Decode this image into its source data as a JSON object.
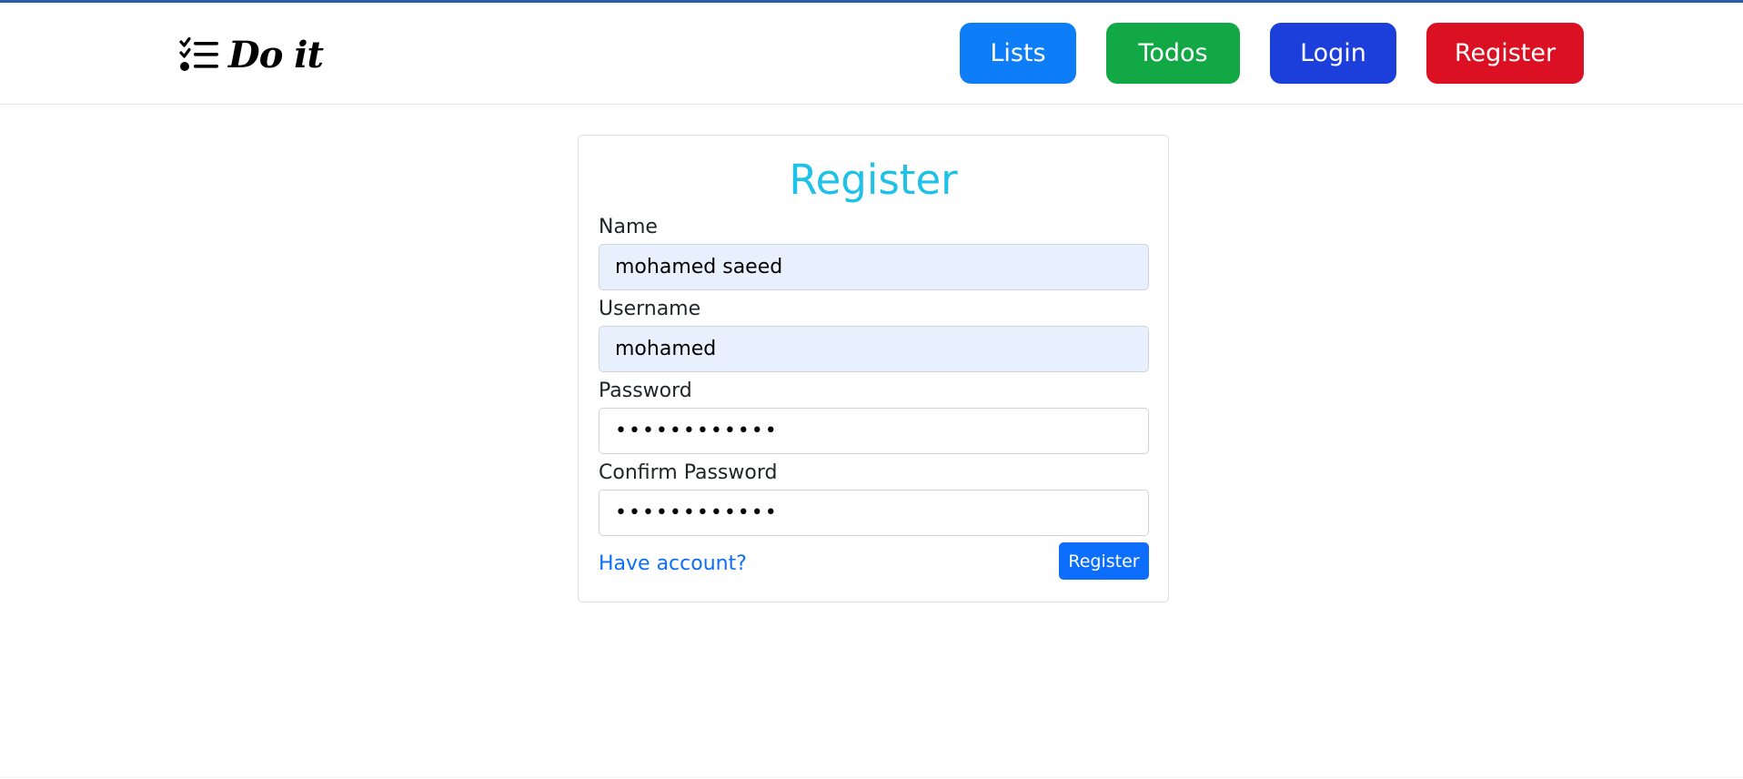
{
  "brand": {
    "name": "Do it",
    "icon": "checklist-icon"
  },
  "nav": {
    "buttons": [
      {
        "label": "Lists",
        "color": "#0d7ef8"
      },
      {
        "label": "Todos",
        "color": "#12a845"
      },
      {
        "label": "Login",
        "color": "#1c3fdc"
      },
      {
        "label": "Register",
        "color": "#db1022"
      }
    ]
  },
  "form": {
    "title": "Register",
    "fields": [
      {
        "label": "Name",
        "value": "mohamed saeed",
        "type": "text"
      },
      {
        "label": "Username",
        "value": "mohamed",
        "type": "text"
      },
      {
        "label": "Password",
        "value": "••••••••••••",
        "type": "password"
      },
      {
        "label": "Confirm Password",
        "value": "••••••••••••",
        "type": "password"
      }
    ],
    "have_account_link": "Have account?",
    "submit_label": "Register"
  },
  "colors": {
    "title": "#1ec1e8",
    "link": "#0d6efd",
    "submit": "#0d6efd",
    "autofill_bg": "#e8f0fe",
    "top_strip": "#2b5fa8"
  }
}
